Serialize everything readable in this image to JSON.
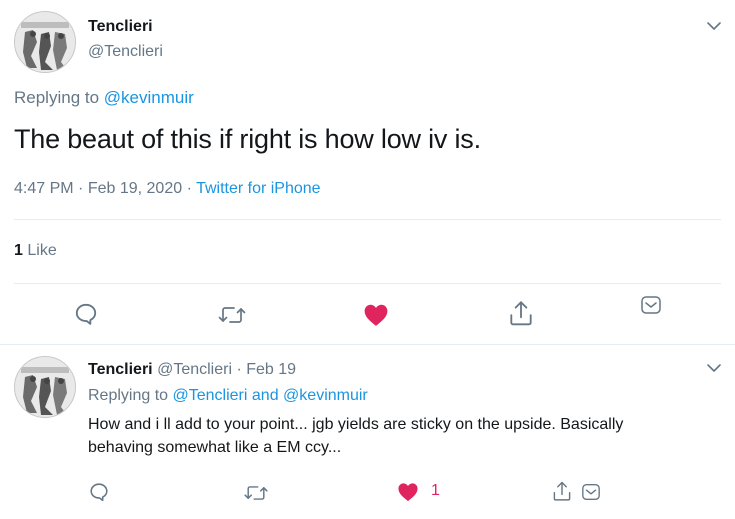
{
  "main_tweet": {
    "display_name": "Tenclieri",
    "handle": "@Tenclieri",
    "replying_label": "Replying to",
    "replying_to": "@kevinmuir",
    "text": "The beaut of this if right is how low iv is.",
    "time": "4:47 PM",
    "dot1": "·",
    "date": "Feb 19, 2020",
    "dot2": "·",
    "source": "Twitter for iPhone",
    "like_count": "1",
    "like_label": "Like"
  },
  "reply_tweet": {
    "display_name": "Tenclieri",
    "handle": "@Tenclieri",
    "dot": "·",
    "date": "Feb 19",
    "replying_label": "Replying to",
    "replying_to_1": "@Tenclieri",
    "and_label": "and",
    "replying_to_2": "@kevinmuir",
    "text_line1": "How and i ll add to your point... jgb yields are sticky on the upside. Basically",
    "text_line2": "behaving somewhat like a EM ccy...",
    "like_count": "1"
  },
  "colors": {
    "text": "#14171a",
    "secondary": "#657786",
    "link": "#1b95e0",
    "like": "#e0245e",
    "divider": "#e6ecf0"
  },
  "icons": [
    "chevron-down-icon",
    "reply-icon",
    "retweet-icon",
    "heart-icon",
    "share-icon",
    "direct-message-icon"
  ]
}
